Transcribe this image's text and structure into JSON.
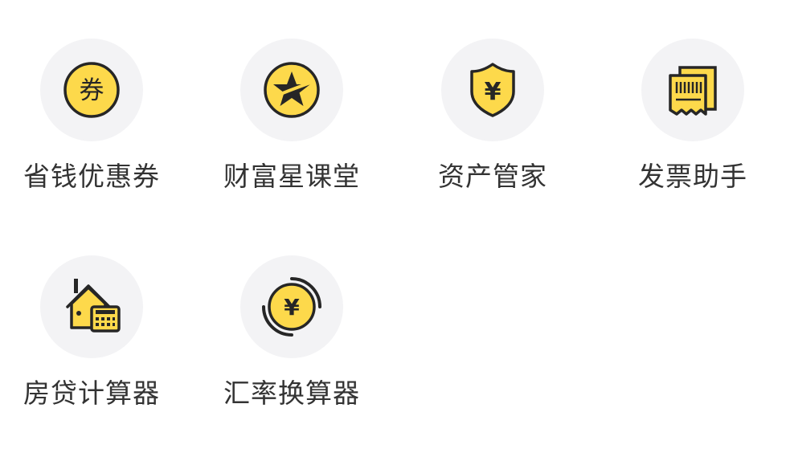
{
  "colors": {
    "accent": "#FDD94B",
    "outline": "#262626",
    "circle_bg": "#F3F3F5",
    "label": "#333333"
  },
  "items": [
    {
      "label": "省钱优惠券",
      "icon": "coupon-icon",
      "icon_text": "券"
    },
    {
      "label": "财富星课堂",
      "icon": "star-icon"
    },
    {
      "label": "资产管家",
      "icon": "shield-yen-icon",
      "icon_text": "¥"
    },
    {
      "label": "发票助手",
      "icon": "invoice-icon"
    },
    {
      "label": "房贷计算器",
      "icon": "house-calculator-icon"
    },
    {
      "label": "汇率换算器",
      "icon": "exchange-yen-icon",
      "icon_text": "¥"
    }
  ]
}
